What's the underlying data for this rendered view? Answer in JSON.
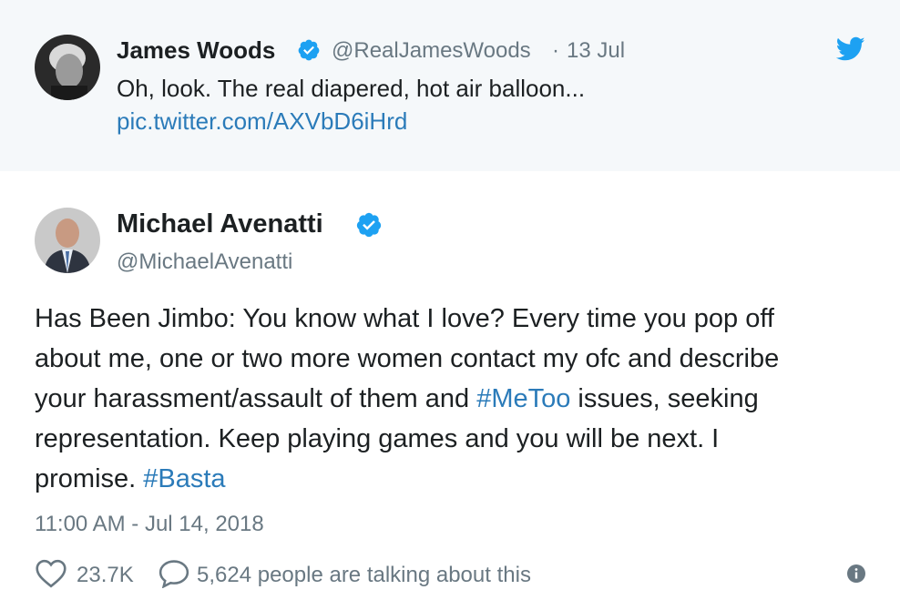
{
  "quoted_tweet": {
    "author_name": "James Woods",
    "handle": "@RealJamesWoods",
    "separator": "·",
    "date": "13 Jul",
    "text": "Oh, look. The real diapered, hot air balloon...",
    "link": "pic.twitter.com/AXVbD6iHrd"
  },
  "tweet": {
    "author_name": "Michael Avenatti",
    "handle": "@MichaelAvenatti",
    "lines": [
      "Has Been Jimbo: You know what I love? Every time you pop off",
      "about me, one or two more women contact my ofc and describe"
    ],
    "line3_prefix": "your harassment/assault of them and ",
    "hashtag_metoo": "#MeToo",
    "line3_suffix": " issues, seeking",
    "line4": "representation. Keep playing games and you will be next. I",
    "line5_prefix": "promise. ",
    "hashtag_basta": "#Basta",
    "timestamp": "11:00 AM - Jul 14, 2018",
    "likes": "23.7K",
    "talking": "5,624 people are talking about this"
  },
  "colors": {
    "link": "#2b7bb9",
    "verified": "#1da1f2",
    "muted": "#697882",
    "twitter_bird": "#1da1f2"
  }
}
